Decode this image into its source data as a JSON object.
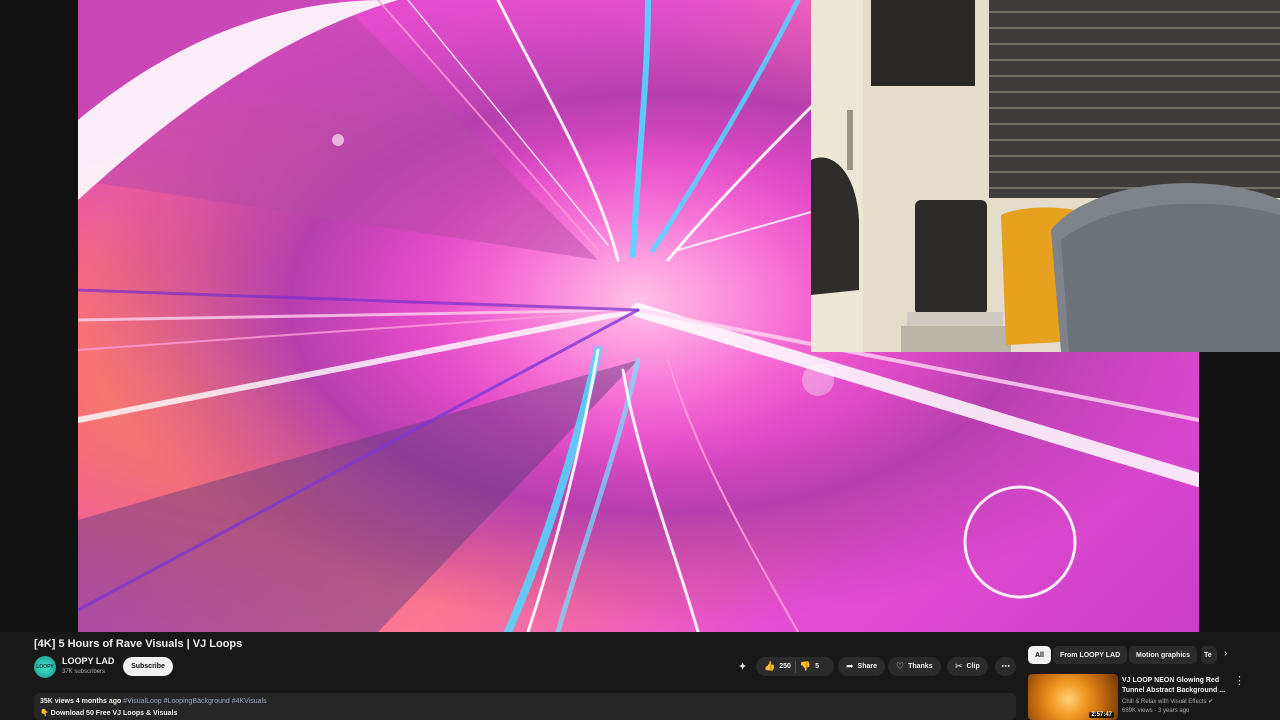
{
  "video": {
    "title": "[4K] 5 Hours of Rave Visuals | VJ Loops"
  },
  "channel": {
    "name": "LOOPY LAD",
    "subscribers": "37K subscribers",
    "avatar_text": "LOOPY",
    "subscribe_label": "Subscribe"
  },
  "actions": {
    "likes": "250",
    "dislikes": "5",
    "share_label": "Share",
    "thanks_label": "Thanks",
    "clip_label": "Clip",
    "more_icon": "more-horizontal-icon"
  },
  "description": {
    "meta": "35K views  4 months ago",
    "tags": "#VisualLoop #LoopingBackground #4KVisuals",
    "line2": "👇 Download 50 Free VJ Loops & Visuals"
  },
  "filters": {
    "chips": [
      "All",
      "From LOOPY LAD",
      "Motion graphics",
      "Te"
    ]
  },
  "recommendation": {
    "title": "VJ LOOP NEON Glowing Red Tunnel Abstract Background ...",
    "channel": "Chill & Relax with Visual Effects ✔",
    "views": "689K views · 3 years ago",
    "duration": "2:57:47"
  },
  "colors": {
    "panel_bg": "#181818",
    "pill_bg": "#2b2b2b",
    "accent_pink": "#e24bc8"
  }
}
